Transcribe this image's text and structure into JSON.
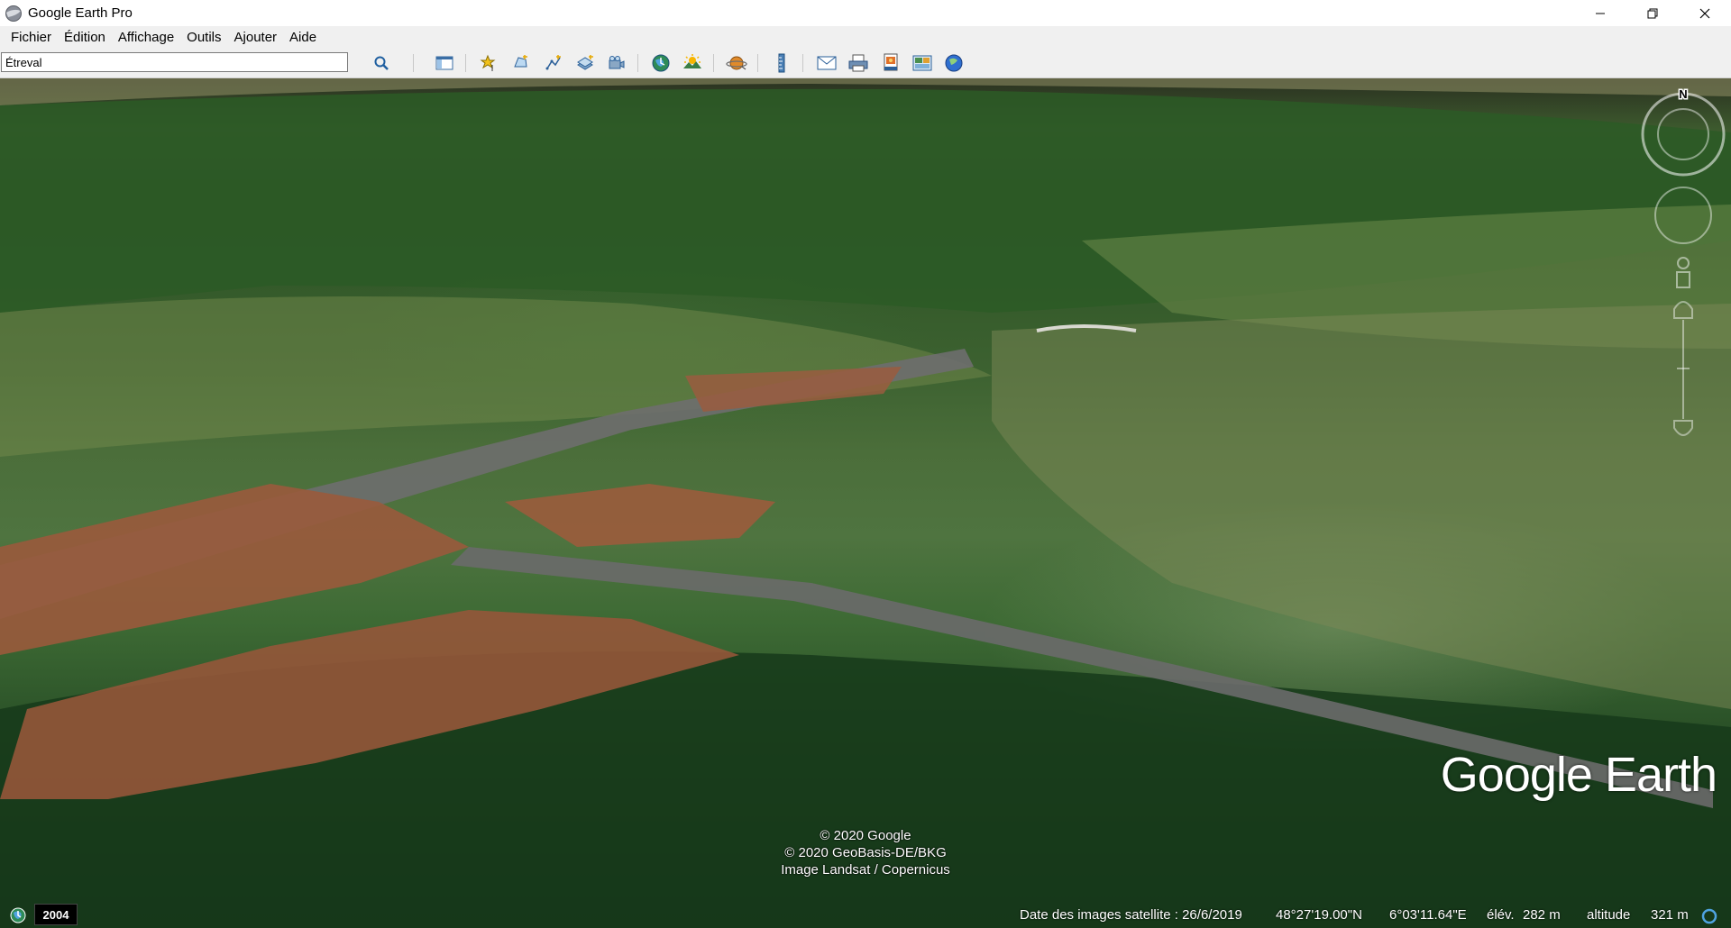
{
  "window": {
    "title": "Google Earth Pro"
  },
  "menu": [
    "Fichier",
    "Édition",
    "Affichage",
    "Outils",
    "Ajouter",
    "Aide"
  ],
  "search": {
    "value": "Étreval"
  },
  "toolbar": {
    "icons": [
      "search-icon",
      "sidebar-icon",
      "placemark-icon",
      "polygon-icon",
      "path-icon",
      "image-overlay-icon",
      "record-tour-icon",
      "historical-imagery-icon",
      "sunlight-icon",
      "planets-icon",
      "ruler-icon",
      "email-icon",
      "print-icon",
      "save-image-icon",
      "map-maker-icon",
      "google-maps-icon"
    ]
  },
  "map": {
    "copyright": [
      "© 2020 Google",
      "© 2020 GeoBasis-DE/BKG",
      "Image Landsat / Copernicus"
    ],
    "brand": "Google Earth",
    "compass_label": "N"
  },
  "status": {
    "year": "2004",
    "imagery_date": "Date des images satellite : 26/6/2019",
    "latitude": "48°27'19.00\"N",
    "longitude": "6°03'11.64\"E",
    "elevation_label": "élév.",
    "elevation": "282 m",
    "altitude_label": "altitude",
    "altitude": "321 m"
  },
  "colors": {
    "toolbar_bg": "#f0f0f0",
    "titlebar_bg": "#ffffff",
    "overlay_text": "#ffffff"
  }
}
